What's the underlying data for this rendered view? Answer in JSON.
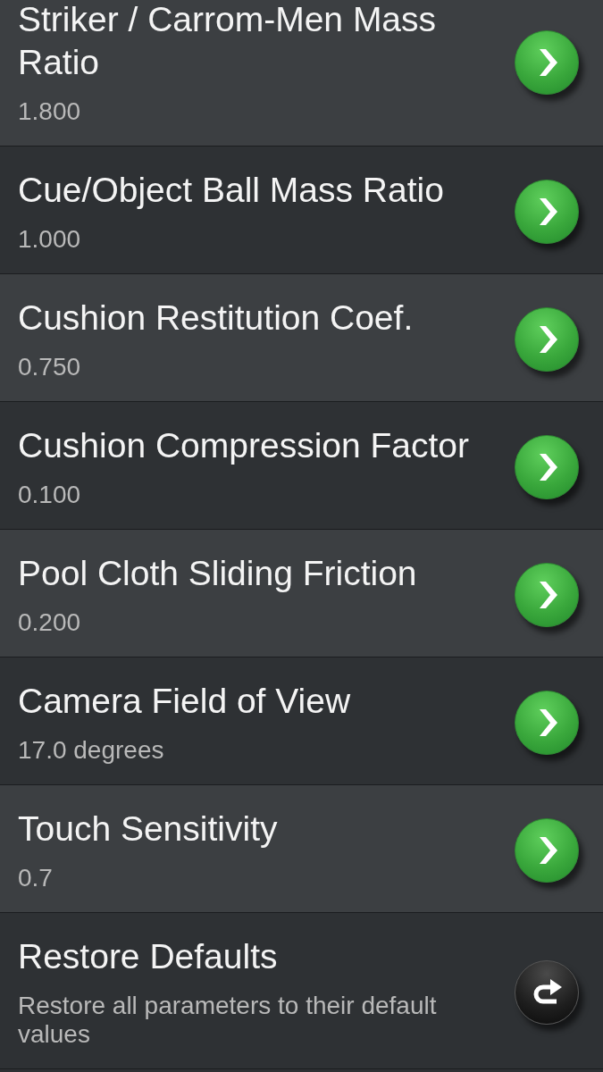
{
  "settings": [
    {
      "kind": "value",
      "title": "Striker / Carrom-Men Mass Ratio",
      "summary": "1.800"
    },
    {
      "kind": "value",
      "title": "Cue/Object Ball Mass Ratio",
      "summary": "1.000"
    },
    {
      "kind": "value",
      "title": "Cushion Restitution Coef.",
      "summary": "0.750"
    },
    {
      "kind": "value",
      "title": "Cushion Compression Factor",
      "summary": "0.100"
    },
    {
      "kind": "value",
      "title": "Pool Cloth Sliding Friction",
      "summary": "0.200"
    },
    {
      "kind": "value",
      "title": "Camera Field of View",
      "summary": "17.0 degrees"
    },
    {
      "kind": "value",
      "title": "Touch Sensitivity",
      "summary": "0.7"
    },
    {
      "kind": "action",
      "title": "Restore Defaults",
      "summary": "Restore all parameters to their default values"
    }
  ]
}
